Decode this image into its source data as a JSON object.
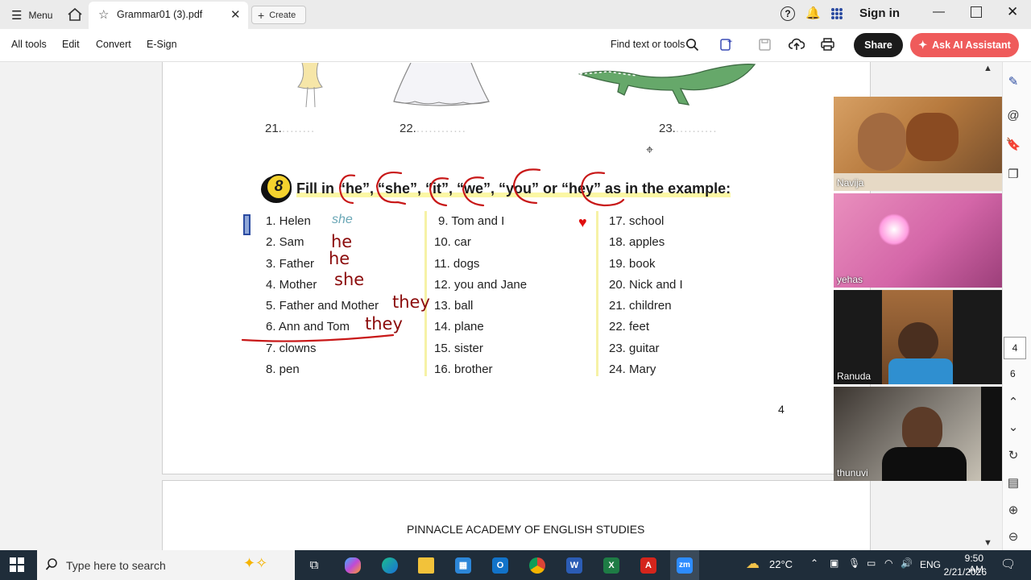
{
  "window": {
    "menu_label": "Menu",
    "tab_title": "Grammar01 (3).pdf",
    "create_label": "Create",
    "sign_in_label": "Sign in"
  },
  "toolbar": {
    "all_tools": "All tools",
    "edit": "Edit",
    "convert": "Convert",
    "esign": "E-Sign",
    "find_label": "Find text or tools",
    "share_label": "Share",
    "ai_label": "Ask AI Assistant"
  },
  "document": {
    "picture_numbers": [
      "21.",
      "22.",
      "23."
    ],
    "exercise_number": "8",
    "instruction": "Fill in “he”, “she”, “it”, “we”, “you” or “hey” as in the example:",
    "example_answer": "she",
    "columns": [
      [
        "1. Helen",
        "2. Sam",
        "3. Father",
        "4. Mother",
        "5. Father and Mother",
        "6. Ann and Tom",
        "7. clowns",
        "8. pen"
      ],
      [
        "9. Tom and I",
        "10. car",
        "11. dogs",
        "12. you and Jane",
        "13. ball",
        "14. plane",
        "15. sister",
        "16. brother"
      ],
      [
        "17. school",
        "18. apples",
        "19. book",
        "20. Nick and I",
        "21. children",
        "22. feet",
        "23. guitar",
        "24. Mary"
      ]
    ],
    "handwritten_answers": [
      "he",
      "he",
      "she",
      "they",
      "they"
    ],
    "page_number": "4",
    "footer": "PINNACLE ACADEMY OF ENGLISH STUDIES"
  },
  "page_nav": {
    "current": "4",
    "total": "6"
  },
  "participants": [
    "Navija",
    "yehas",
    "Ranuda",
    "thunuvi"
  ],
  "taskbar": {
    "search_placeholder": "Type here to search",
    "weather": "22°C",
    "language": "ENG",
    "time": "9:50 AM",
    "date": "2/21/2026"
  },
  "colors": {
    "accent_ai": "#ef5b5b",
    "share": "#1b1b1b",
    "ink": "#8b0b0b",
    "taskbar": "#1f2d3a"
  }
}
